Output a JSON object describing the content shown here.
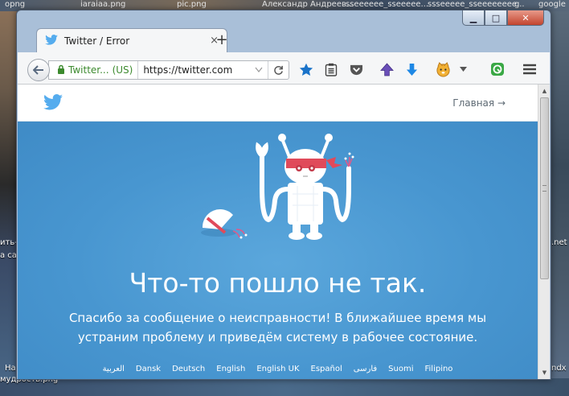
{
  "desktop": {
    "top_labels": [
      "opng",
      "iaraiaa.png",
      "pic.png",
      "Александр Андреев...",
      "sseeeeee_sseeeee...",
      "ssseeeee_sseeeeeeee...",
      "g",
      "google"
    ],
    "left_labels": [
      "ить-ч",
      "а са",
      "На"
    ],
    "right_labels": [
      ".net",
      "ndx"
    ],
    "bottom_label": "мудрость.png"
  },
  "window": {
    "controls": {
      "minimize": "▁",
      "maximize": "□",
      "close": "✕"
    }
  },
  "tab": {
    "title": "Twitter / Error",
    "close": "×",
    "new_tab": "+"
  },
  "toolbar": {
    "identity_label": "Twitter...",
    "identity_country": "(US)",
    "url": "https://twitter.com",
    "icons": [
      "back-icon",
      "star-icon",
      "reading-list-icon",
      "pocket-icon",
      "upload-arrow-icon",
      "download-arrow-icon",
      "fox-addon-icon",
      "dropdown-icon",
      "green-addon-icon",
      "menu-icon"
    ]
  },
  "page": {
    "home_link": "Главная →",
    "error_title": "Что-то пошло не так.",
    "error_message": "Спасибо за сообщение о неисправности! В ближайшее время мы устраним проблему и приведём систему в рабочее состояние.",
    "languages": [
      "العربية",
      "Dansk",
      "Deutsch",
      "English",
      "English UK",
      "Español",
      "فارسی",
      "Suomi",
      "Filipino"
    ]
  },
  "colors": {
    "hero_blue": "#4896d0",
    "twitter_blue": "#55acee",
    "secure_green": "#3c8a2e"
  }
}
